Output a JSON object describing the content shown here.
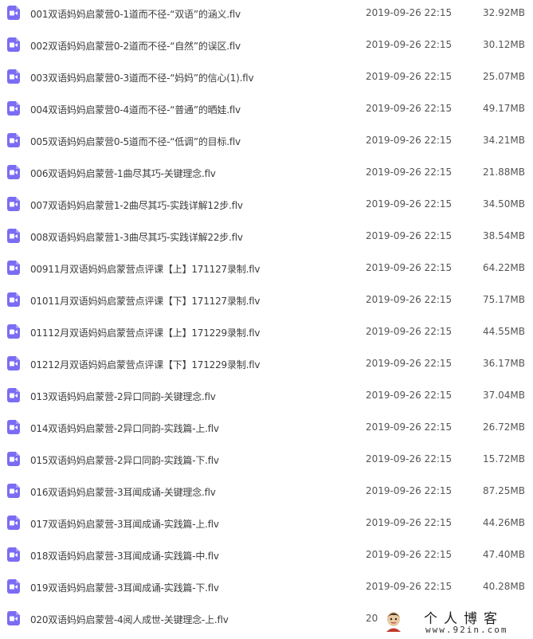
{
  "colors": {
    "icon": "#7b6cf4",
    "text": "#3c3c3c"
  },
  "files": [
    {
      "name": "001双语妈妈启蒙营0-1道而不径-“双语”的涵义.flv",
      "date": "2019-09-26 22:15",
      "size": "32.92MB",
      "icon": "video-file-icon"
    },
    {
      "name": "002双语妈妈启蒙营0-2道而不径-“自然”的误区.flv",
      "date": "2019-09-26 22:15",
      "size": "30.12MB",
      "icon": "video-file-icon"
    },
    {
      "name": "003双语妈妈启蒙营0-3道而不径-“妈妈”的信心(1).flv",
      "date": "2019-09-26 22:15",
      "size": "25.07MB",
      "icon": "video-file-icon"
    },
    {
      "name": "004双语妈妈启蒙营0-4道而不径-“普通”的晒娃.flv",
      "date": "2019-09-26 22:15",
      "size": "49.17MB",
      "icon": "video-file-icon"
    },
    {
      "name": "005双语妈妈启蒙营0-5道而不径-“低调”的目标.flv",
      "date": "2019-09-26 22:15",
      "size": "34.21MB",
      "icon": "video-file-icon"
    },
    {
      "name": "006双语妈妈启蒙营-1曲尽其巧-关键理念.flv",
      "date": "2019-09-26 22:15",
      "size": "21.88MB",
      "icon": "video-file-icon"
    },
    {
      "name": "007双语妈妈启蒙营1-2曲尽其巧-实践详解12步.flv",
      "date": "2019-09-26 22:15",
      "size": "34.50MB",
      "icon": "video-file-icon"
    },
    {
      "name": "008双语妈妈启蒙营1-3曲尽其巧-实践详解22步.flv",
      "date": "2019-09-26 22:15",
      "size": "38.54MB",
      "icon": "video-file-icon"
    },
    {
      "name": "00911月双语妈妈启蒙营点评课【上】171127录制.flv",
      "date": "2019-09-26 22:15",
      "size": "64.22MB",
      "icon": "video-file-icon"
    },
    {
      "name": "01011月双语妈妈启蒙营点评课【下】171127录制.flv",
      "date": "2019-09-26 22:15",
      "size": "75.17MB",
      "icon": "video-file-icon"
    },
    {
      "name": "01112月双语妈妈启蒙营点评课【上】171229录制.flv",
      "date": "2019-09-26 22:15",
      "size": "44.55MB",
      "icon": "video-file-icon"
    },
    {
      "name": "01212月双语妈妈启蒙营点评课【下】171229录制.flv",
      "date": "2019-09-26 22:15",
      "size": "36.17MB",
      "icon": "video-file-icon"
    },
    {
      "name": "013双语妈妈启蒙营-2异口同韵-关键理念.flv",
      "date": "2019-09-26 22:15",
      "size": "37.04MB",
      "icon": "video-file-icon"
    },
    {
      "name": "014双语妈妈启蒙营-2异口同韵-实践篇-上.flv",
      "date": "2019-09-26 22:15",
      "size": "26.72MB",
      "icon": "video-file-icon"
    },
    {
      "name": "015双语妈妈启蒙营-2异口同韵-实践篇-下.flv",
      "date": "2019-09-26 22:15",
      "size": "15.72MB",
      "icon": "video-file-icon"
    },
    {
      "name": "016双语妈妈启蒙营-3耳闻成诵-关键理念.flv",
      "date": "2019-09-26 22:15",
      "size": "87.25MB",
      "icon": "video-file-icon"
    },
    {
      "name": "017双语妈妈启蒙营-3耳闻成诵-实践篇-上.flv",
      "date": "2019-09-26 22:15",
      "size": "44.26MB",
      "icon": "video-file-icon"
    },
    {
      "name": "018双语妈妈启蒙营-3耳闻成诵-实践篇-中.flv",
      "date": "2019-09-26 22:15",
      "size": "47.40MB",
      "icon": "video-file-icon"
    },
    {
      "name": "019双语妈妈启蒙营-3耳闻成诵-实践篇-下.flv",
      "date": "2019-09-26 22:15",
      "size": "40.28MB",
      "icon": "video-file-icon"
    },
    {
      "name": "020双语妈妈启蒙营-4阅人成世-关键理念-上.flv",
      "date": "20",
      "size": "",
      "icon": "video-file-icon"
    }
  ],
  "watermark": {
    "title": "个人博客",
    "url": "www.92in.com"
  }
}
